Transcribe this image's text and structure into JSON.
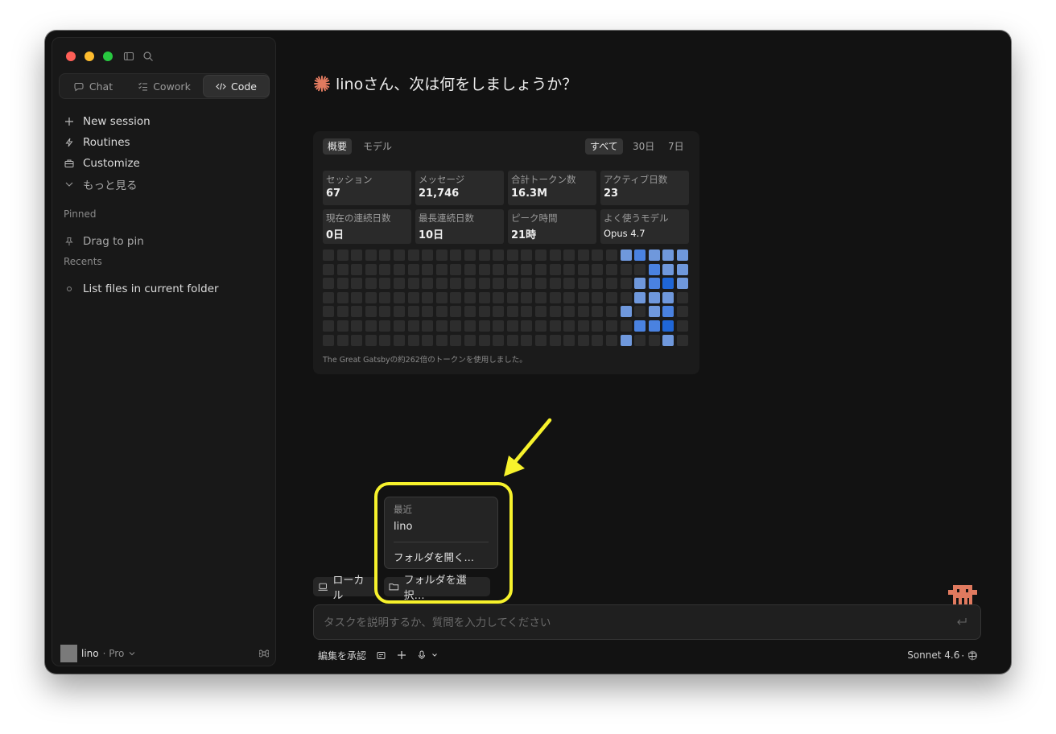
{
  "sidebar": {
    "mode_tabs": [
      {
        "label": "Chat",
        "icon": "chat-bubble-icon"
      },
      {
        "label": "Cowork",
        "icon": "checklist-icon"
      },
      {
        "label": "Code",
        "icon": "code-icon",
        "active": true
      }
    ],
    "nav_items": [
      {
        "label": "New session",
        "icon": "plus-icon"
      },
      {
        "label": "Routines",
        "icon": "lightning-icon"
      },
      {
        "label": "Customize",
        "icon": "briefcase-icon"
      },
      {
        "label": "もっと見る",
        "icon": "chevron-down-icon"
      }
    ],
    "pinned": {
      "label": "Pinned",
      "placeholder": "Drag to pin"
    },
    "recents": {
      "label": "Recents",
      "items": [
        "List files in current folder"
      ]
    },
    "user": {
      "name": "lino",
      "plan": "· Pro"
    }
  },
  "main": {
    "greeting": "linoさん、次は何をしましょうか？"
  },
  "stats_card": {
    "tabs": [
      "概要",
      "モデル"
    ],
    "ranges": [
      "すべて",
      "30日",
      "7日"
    ],
    "stats": [
      {
        "label": "セッション",
        "value": "67"
      },
      {
        "label": "メッセージ",
        "value": "21,746"
      },
      {
        "label": "合計トークン数",
        "value": "16.3M"
      },
      {
        "label": "アクティブ日数",
        "value": "23"
      },
      {
        "label": "現在の連続日数",
        "value": "0日"
      },
      {
        "label": "最長連続日数",
        "value": "10日"
      },
      {
        "label": "ピーク時間",
        "value": "21時"
      },
      {
        "label": "よく使うモデル",
        "value": "Opus 4.7"
      }
    ],
    "heatmap": {
      "cols": 26,
      "rows": 7,
      "colors": {
        "empty": "#2d2d2d",
        "l1": "#6f98dc",
        "l2": "#4a82e0",
        "l3": "#1f66d6"
      },
      "active": [
        [
          21,
          0,
          "l1"
        ],
        [
          22,
          0,
          "l2"
        ],
        [
          23,
          0,
          "l1"
        ],
        [
          24,
          0,
          "l1"
        ],
        [
          25,
          0,
          "l1"
        ],
        [
          23,
          1,
          "l2"
        ],
        [
          24,
          1,
          "l1"
        ],
        [
          25,
          1,
          "l1"
        ],
        [
          22,
          2,
          "l1"
        ],
        [
          23,
          2,
          "l2"
        ],
        [
          24,
          2,
          "l3"
        ],
        [
          25,
          2,
          "l1"
        ],
        [
          22,
          3,
          "l1"
        ],
        [
          23,
          3,
          "l1"
        ],
        [
          24,
          3,
          "l1"
        ],
        [
          21,
          4,
          "l1"
        ],
        [
          23,
          4,
          "l1"
        ],
        [
          24,
          4,
          "l2"
        ],
        [
          22,
          5,
          "l2"
        ],
        [
          23,
          5,
          "l2"
        ],
        [
          24,
          5,
          "l3"
        ],
        [
          21,
          6,
          "l1"
        ],
        [
          24,
          6,
          "l1"
        ]
      ]
    },
    "footer": "The Great Gatsbyの約262倍のトークンを使用しました。"
  },
  "folder_popup": {
    "header": "最近",
    "recent_item": "lino",
    "open_folder": "フォルダを開く…"
  },
  "env_chip": {
    "label": "ローカル"
  },
  "folder_chip": {
    "label": "フォルダを選択…"
  },
  "composer": {
    "placeholder": "タスクを説明するか、質問を入力してください"
  },
  "bottom_bar": {
    "approve_label": "編集を承認",
    "model_label": "Sonnet 4.6",
    "effort_label": "· 中"
  },
  "colors": {
    "accent": "#e07a5f",
    "highlight": "#f7f22c",
    "background": "#121212"
  }
}
